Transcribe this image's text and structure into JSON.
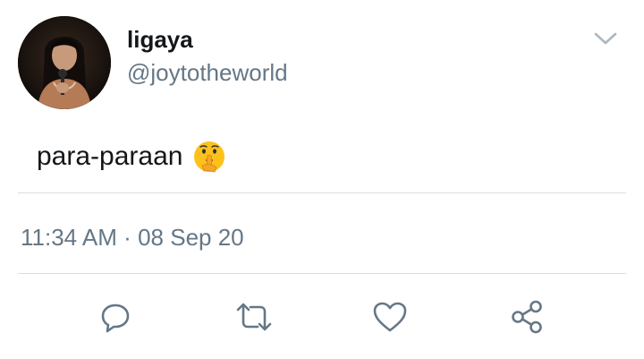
{
  "author": {
    "display_name": "ligaya",
    "handle": "@joytotheworld"
  },
  "tweet": {
    "text": "para-paraan",
    "emoji": "shushing-face"
  },
  "meta": {
    "time": "11:34 AM",
    "separator": "·",
    "date": "08 Sep 20"
  },
  "actions": {
    "reply_icon": "speech-bubble",
    "retweet_icon": "retweet-arrows",
    "like_icon": "heart",
    "share_icon": "share-nodes"
  },
  "colors": {
    "text": "#14171a",
    "secondary": "#657786",
    "divider": "#d9dee2",
    "icon": "#657786"
  }
}
